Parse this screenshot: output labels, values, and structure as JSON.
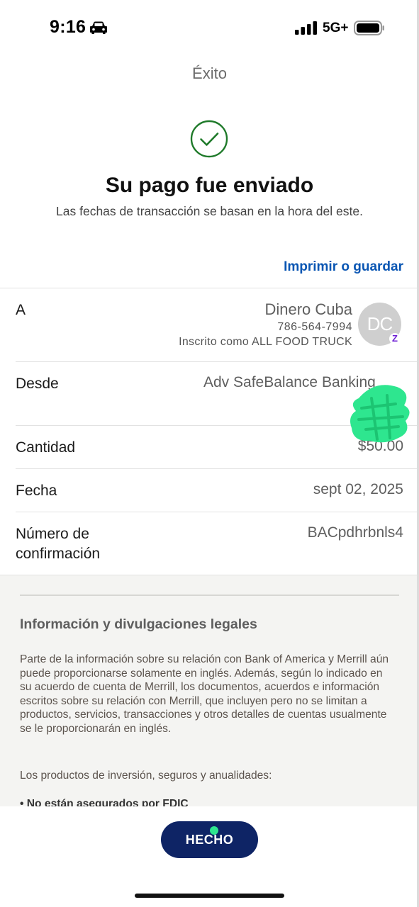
{
  "status_bar": {
    "time": "9:16",
    "network": "5G+",
    "icons": [
      "car-icon",
      "cellular-signal-icon",
      "battery-icon"
    ]
  },
  "header": {
    "title": "Éxito"
  },
  "confirmation": {
    "icon": "checkmark-circle-icon",
    "headline": "Su pago fue enviado",
    "subline": "Las fechas de transacción se basan en la hora del este."
  },
  "actions": {
    "print_label": "Imprimir o guardar"
  },
  "details": {
    "to": {
      "label": "A",
      "name": "Dinero Cuba",
      "phone": "786-564-7994",
      "enrolled_as": "Inscrito como ALL FOOD TRUCK",
      "avatar_initials": "DC",
      "badge_icon": "zelle-icon",
      "badge_glyph": "Z"
    },
    "from": {
      "label": "Desde",
      "value": "Adv SafeBalance Banking"
    },
    "amount": {
      "label": "Cantidad",
      "value": "$50.00"
    },
    "date": {
      "label": "Fecha",
      "value": "sept 02, 2025"
    },
    "confirmation_number": {
      "label": "Número de confirmación",
      "value": "BACpdhrbnls4"
    }
  },
  "legal": {
    "title": "Información y divulgaciones legales",
    "paragraph": "Parte de la información sobre su relación con Bank of America y Merrill aún puede proporcionarse solamente en inglés. Además, según lo indicado en su acuerdo de cuenta de Merrill, los documentos, acuerdos e información escritos sobre su relación con Merrill, que incluyen pero no se limitan a productos, servicios, transacciones y otros detalles de cuentas usualmente se le proporcionarán en inglés.",
    "subheading": "Los productos de inversión, seguros y anualidades:",
    "bullet": "• No están asegurados por FDIC"
  },
  "footer": {
    "done_label": "HECHO"
  },
  "colors": {
    "link": "#0a56b3",
    "success": "#1f7a2a",
    "button": "#0e2465",
    "scribble": "#2ee68f"
  }
}
